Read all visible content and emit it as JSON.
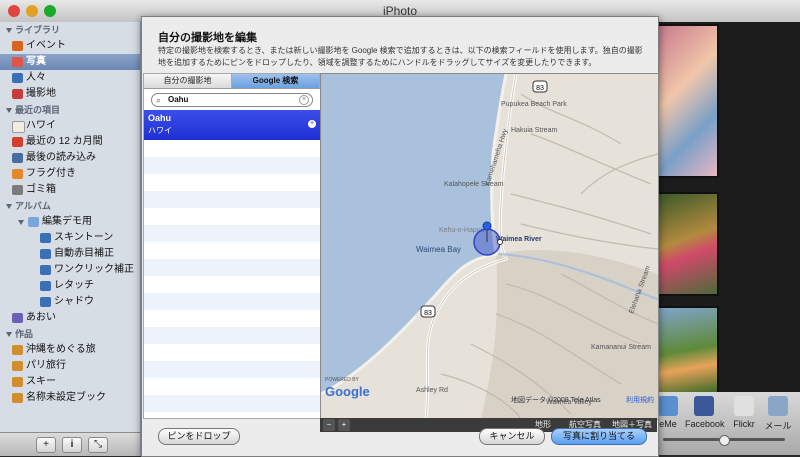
{
  "window": {
    "title": "iPhoto"
  },
  "sidebar": {
    "library_header": "ライブラリ",
    "library": [
      {
        "label": "イベント",
        "icon": "events-icon",
        "color": "#d8641f"
      },
      {
        "label": "写真",
        "icon": "photos-icon",
        "color": "#e0554a"
      },
      {
        "label": "人々",
        "icon": "faces-icon",
        "color": "#3b6fb6"
      },
      {
        "label": "撮影地",
        "icon": "places-icon",
        "color": "#c43d3d"
      }
    ],
    "recent_header": "最近の項目",
    "recent": [
      {
        "label": "ハワイ",
        "icon": "event-icon",
        "color": "#f1ede2"
      },
      {
        "label": "最近の 12 カ月間",
        "icon": "calendar-icon",
        "color": "#d0402f"
      },
      {
        "label": "最後の読み込み",
        "icon": "import-icon",
        "color": "#4a6da0"
      },
      {
        "label": "フラグ付き",
        "icon": "flag-icon",
        "color": "#e4882a"
      },
      {
        "label": "ゴミ箱",
        "icon": "trash-icon",
        "color": "#7b7b7b"
      }
    ],
    "albums_header": "アルバム",
    "album_folder": {
      "label": "編集デモ用",
      "icon": "folder-icon",
      "color": "#7aa6dc"
    },
    "albums": [
      {
        "label": "スキントーン",
        "icon": "album-icon",
        "color": "#3b6fb6"
      },
      {
        "label": "自動赤目補正",
        "icon": "album-icon",
        "color": "#3b6fb6"
      },
      {
        "label": "ワンクリック補正",
        "icon": "album-icon",
        "color": "#3b6fb6"
      },
      {
        "label": "レタッチ",
        "icon": "album-icon",
        "color": "#3b6fb6"
      },
      {
        "label": "シャドウ",
        "icon": "album-icon",
        "color": "#3b6fb6"
      }
    ],
    "album_extra": {
      "label": "あおい",
      "icon": "smart-album-icon",
      "color": "#6c5fb8"
    },
    "projects_header": "作品",
    "projects": [
      {
        "label": "沖縄をめぐる旅",
        "icon": "book-icon",
        "color": "#d08e2f"
      },
      {
        "label": "パリ旅行",
        "icon": "book-icon",
        "color": "#d08e2f"
      },
      {
        "label": "スキー",
        "icon": "book-icon",
        "color": "#d08e2f"
      },
      {
        "label": "名称未設定ブック",
        "icon": "book-icon",
        "color": "#d08e2f"
      }
    ],
    "footer": {
      "add": "+",
      "info": "i",
      "fullscreen": "⤡"
    }
  },
  "sheet": {
    "title": "自分の撮影地を編集",
    "description": "特定の撮影地を検索するとき、または新しい撮影地を Google 検索で追加するときは、以下の検索フィールドを使用します。独自の撮影地を追加するためにピンをドロップしたり、領域を調整するためにハンドルをドラッグしてサイズを変更したりできます。",
    "tabs": [
      "自分の撮影地",
      "Google 検索"
    ],
    "search_value": "Oahu",
    "result": {
      "name": "Oahu",
      "sub": "ハワイ"
    },
    "map": {
      "labels": [
        "Pupukea Beach Park",
        "Hakuia Stream",
        "Kamehameha Hwy",
        "Kalahopele Stream",
        "Kehu-o-Hapuu",
        "Waimea River",
        "Waimea Bay",
        "Elehaha Stream",
        "Kamananui Stream",
        "Ashley Rd",
        "Waimea Valley"
      ],
      "route_markers": [
        "83",
        "83"
      ],
      "copyright": "地図データ ©2009 Tele Atlas",
      "terms": "利用規約",
      "powered": "POWERED BY",
      "logo": "Google"
    },
    "map_toolbar": {
      "zoom_out": "−",
      "zoom_in": "+",
      "terrain": "地形",
      "satellite": "航空写真",
      "hybrid": "地図＋写真"
    },
    "buttons": {
      "drop_pin": "ピンをドロップ",
      "cancel": "キャンセル",
      "assign": "写真に割り当てる"
    }
  },
  "share": [
    {
      "label": "eMe",
      "icon": "mobileme-icon",
      "color": "#5a8fd0"
    },
    {
      "label": "Facebook",
      "icon": "facebook-icon",
      "color": "#3b5998"
    },
    {
      "label": "Flickr",
      "icon": "flickr-icon",
      "color": "#e0e0e0"
    },
    {
      "label": "メール",
      "icon": "mail-icon",
      "color": "#8aa6c6"
    }
  ]
}
